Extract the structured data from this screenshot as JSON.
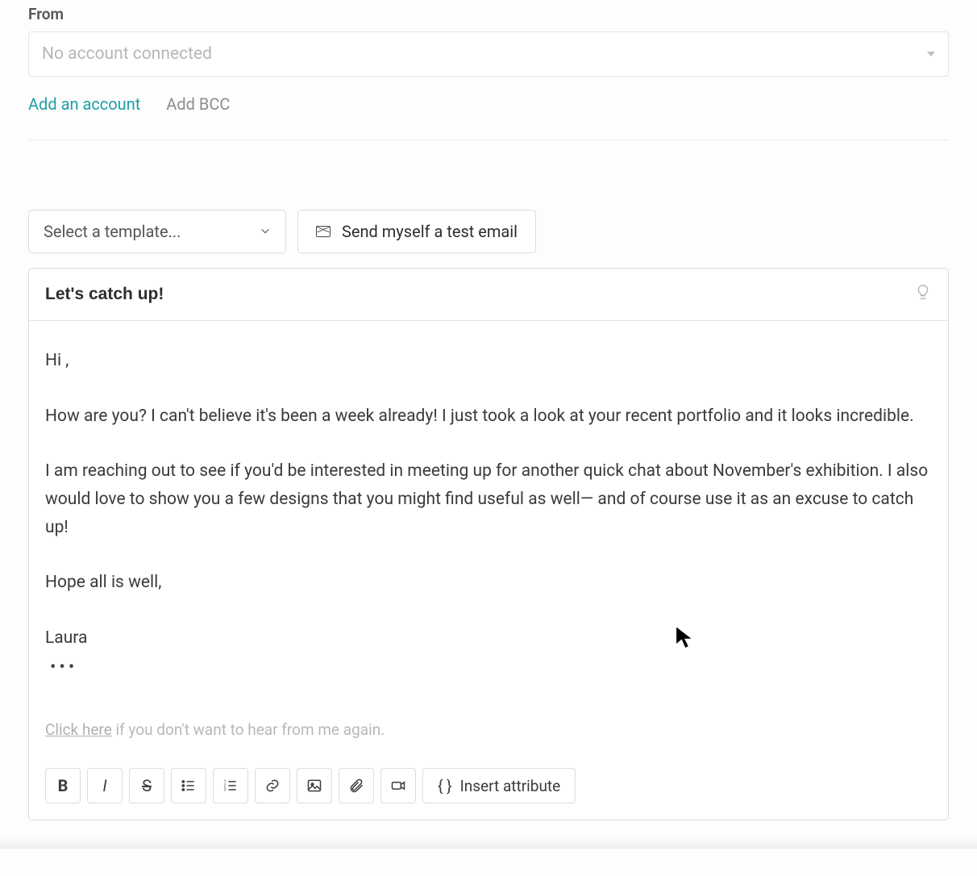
{
  "from": {
    "label": "From",
    "placeholder": "No account connected"
  },
  "links": {
    "add_account": "Add an account",
    "add_bcc": "Add BCC"
  },
  "template_select": {
    "placeholder": "Select a template..."
  },
  "test_email_btn": "Send myself a test email",
  "subject": "Let's catch up!",
  "body": {
    "greeting": "Hi ,",
    "p1": "How are you? I can't believe it's been a week already! I just took a look at your recent portfolio and it looks incredible.",
    "p2": "I am reaching out to see if you'd be interested in meeting up for another quick chat about November's exhibition. I also would love to show you a few designs that you might find useful as well— and of course use it as an excuse to catch up!",
    "closing": "Hope all is well,",
    "signature": "Laura"
  },
  "unsubscribe": {
    "link_text": "Click here",
    "rest": " if you don't want to hear from me again."
  },
  "toolbar": {
    "bold": "B",
    "italic": "I",
    "strike": "S",
    "insert_attribute": "Insert attribute",
    "braces": "{ }"
  }
}
